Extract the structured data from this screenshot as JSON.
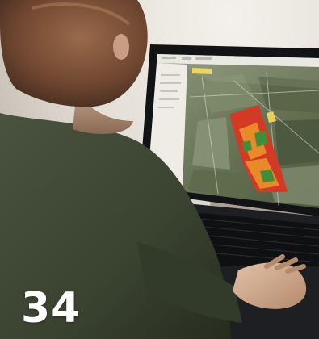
{
  "page_number": "34",
  "photo": {
    "subject": "person-using-laptop-with-field-map",
    "map_palette": {
      "satellite_dark": "#4f5a42",
      "satellite_mid": "#6f7a5e",
      "satellite_light": "#9aa38a",
      "yield_high": "#d33a26",
      "yield_mid": "#e88a2a",
      "yield_low": "#3f8f3a"
    },
    "sweater_color": "#3e4632",
    "wall_color": "#e6e2dc",
    "hair_color": "#7a4f34"
  }
}
